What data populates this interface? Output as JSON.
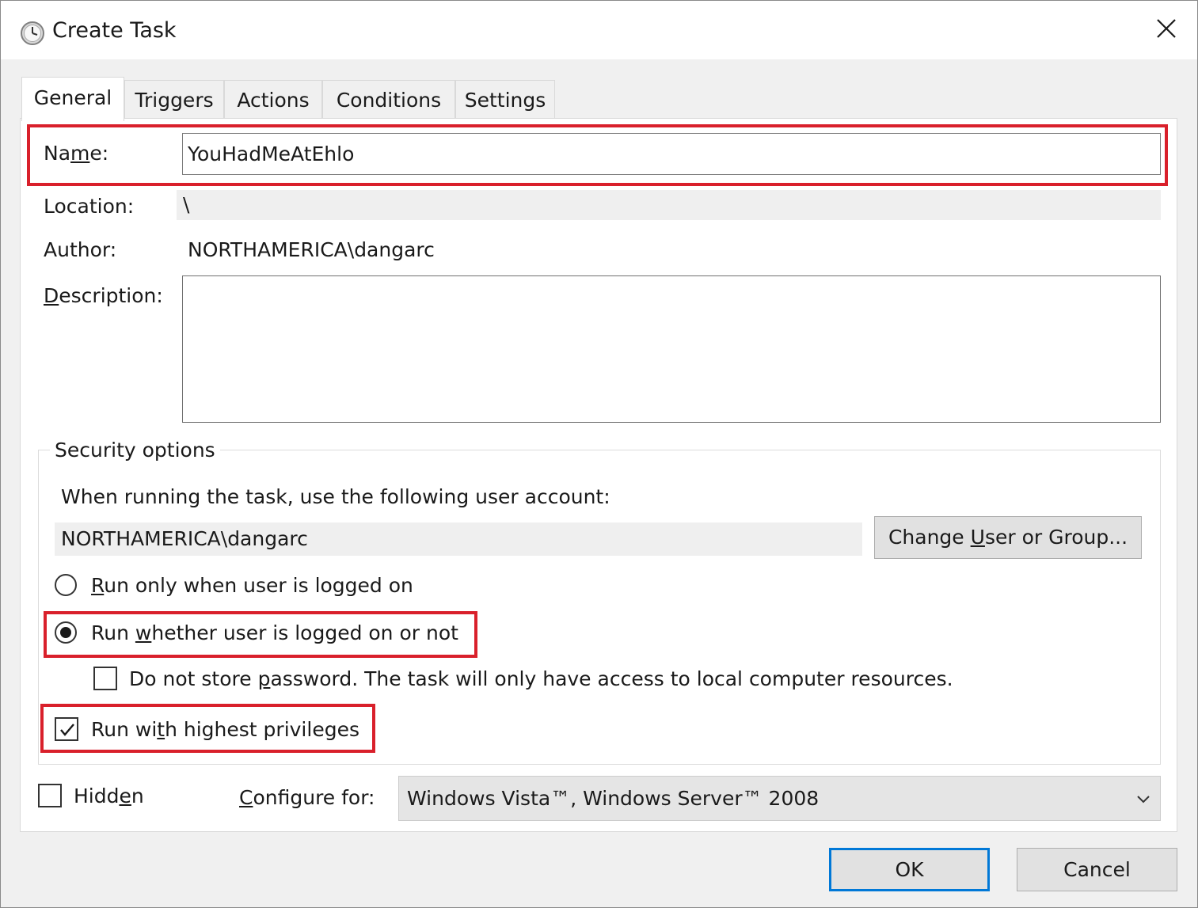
{
  "window": {
    "title": "Create Task",
    "title_icon": "clock-icon",
    "close_icon": "close-icon"
  },
  "tabs": [
    {
      "label": "General",
      "active": true
    },
    {
      "label": "Triggers",
      "active": false
    },
    {
      "label": "Actions",
      "active": false
    },
    {
      "label": "Conditions",
      "active": false
    },
    {
      "label": "Settings",
      "active": false
    }
  ],
  "general": {
    "name_label_a": "Na",
    "name_label_u": "m",
    "name_label_b": "e:",
    "name_value": "YouHadMeAtEhlo",
    "location_label": "Location:",
    "location_value": "\\",
    "author_label": "Author:",
    "author_value": "NORTHAMERICA\\dangarc",
    "description_label_u": "D",
    "description_label_b": "escription:",
    "description_value": ""
  },
  "security": {
    "legend": "Security options",
    "account_prompt": "When running the task, use the following user account:",
    "account_value": "NORTHAMERICA\\dangarc",
    "change_user_a": "Change ",
    "change_user_u": "U",
    "change_user_b": "ser or Group...",
    "radio_logged_on_u": "R",
    "radio_logged_on_b": "un only when user is logged on",
    "radio_logged_on_selected": false,
    "radio_whether_a": "Run ",
    "radio_whether_u": "w",
    "radio_whether_b": "hether user is logged on or not",
    "radio_whether_selected": true,
    "no_store_a": "Do not store ",
    "no_store_u": "p",
    "no_store_b": "assword.  The task will only have access to local computer resources.",
    "no_store_checked": false,
    "highest_a": "Run wi",
    "highest_u": "t",
    "highest_b": "h highest privileges",
    "highest_checked": true
  },
  "bottom": {
    "hidden_a": "Hidd",
    "hidden_u": "e",
    "hidden_b": "n",
    "hidden_checked": false,
    "configure_u": "C",
    "configure_b": "onfigure for:",
    "configure_value": "Windows Vista™, Windows Server™ 2008",
    "dropdown_icon": "chevron-down-icon"
  },
  "buttons": {
    "ok": "OK",
    "cancel": "Cancel"
  },
  "colors": {
    "highlight": "#d9202b",
    "focus": "#0078d7"
  }
}
